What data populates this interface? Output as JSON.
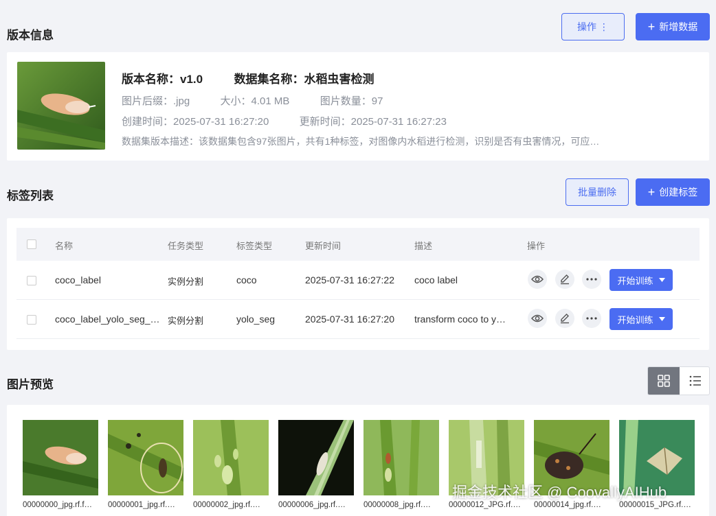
{
  "version_section": {
    "title": "版本信息",
    "ops_label": "操作 ⋮",
    "add_label": "新增数据",
    "name_line": "版本名称：v1.0",
    "dataset_line": "数据集名称：水稻虫害检测",
    "suffix": "图片后缀：.jpg",
    "size": "大小：4.01 MB",
    "count": "图片数量：97",
    "created": "创建时间：2025-07-31 16:27:20",
    "updated": "更新时间：2025-07-31 16:27:23",
    "description": "数据集版本描述：该数据集包含97张图片，共有1种标签，对图像内水稻进行检测，识别是否有虫害情况，可应…"
  },
  "label_section": {
    "title": "标签列表",
    "batch_delete": "批量删除",
    "create_label": "创建标签",
    "columns": [
      "名称",
      "任务类型",
      "标签类型",
      "更新时间",
      "描述",
      "操作"
    ],
    "rows": [
      {
        "name": "coco_label",
        "task": "实例分割",
        "type": "coco",
        "time": "2025-07-31 16:27:22",
        "desc": "coco label",
        "action": "开始训练"
      },
      {
        "name": "coco_label_yolo_seg_…",
        "task": "实例分割",
        "type": "yolo_seg",
        "time": "2025-07-31 16:27:20",
        "desc": "transform coco to y…",
        "action": "开始训练"
      }
    ]
  },
  "preview_section": {
    "title": "图片预览",
    "images": [
      {
        "caption": "00000000_jpg.rf.f…"
      },
      {
        "caption": "00000001_jpg.rf.…"
      },
      {
        "caption": "00000002_jpg.rf.…"
      },
      {
        "caption": "00000006_jpg.rf.…"
      },
      {
        "caption": "00000008_jpg.rf.…"
      },
      {
        "caption": "00000012_JPG.rf.…"
      },
      {
        "caption": "00000014_jpg.rf.…"
      },
      {
        "caption": "00000015_JPG.rf.…"
      }
    ]
  },
  "watermark": "掘金技术社区 @ CoovallyAIHub",
  "colors": {
    "primary": "#4b6cf2",
    "background": "#f2f3f7"
  }
}
